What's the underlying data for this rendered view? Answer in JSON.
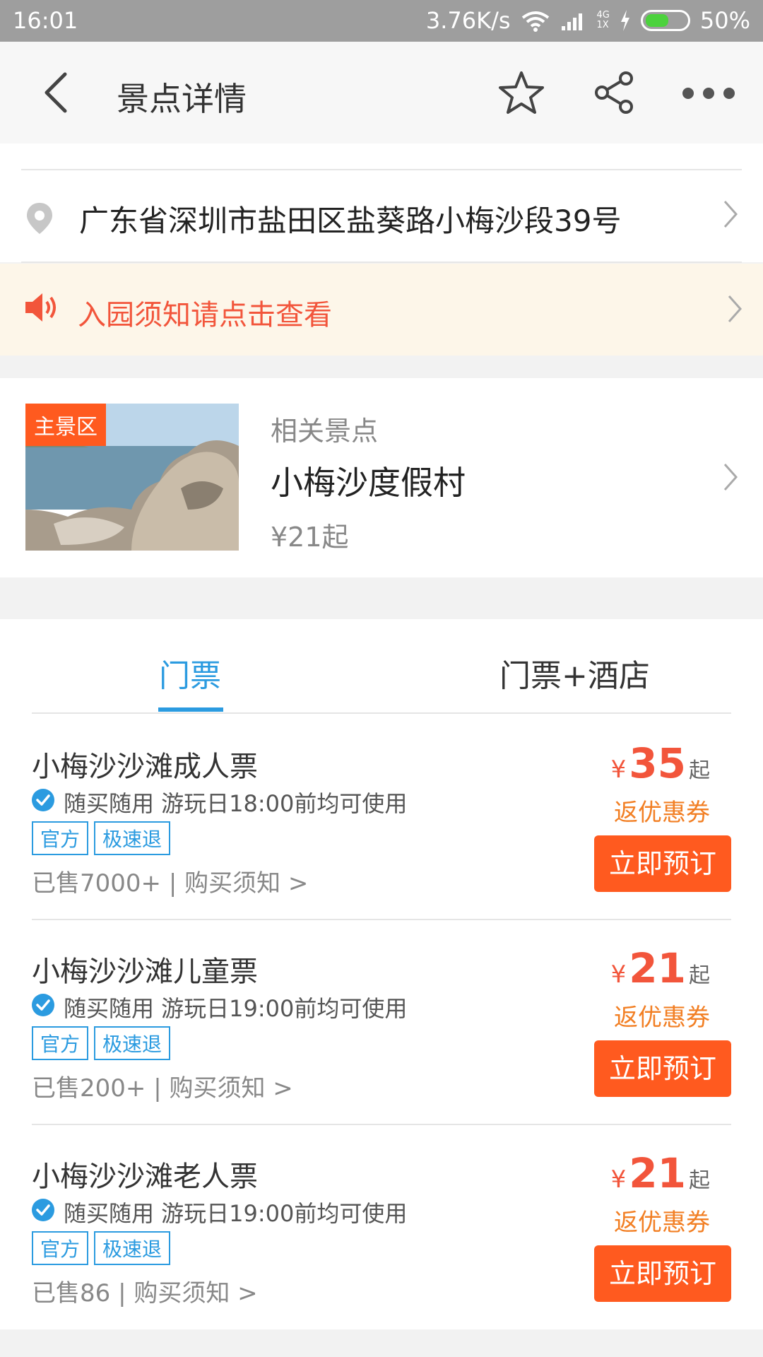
{
  "status_bar": {
    "time": "16:01",
    "speed": "3.76K/s",
    "network_top": "4G",
    "network_bottom": "1X",
    "battery": "50%",
    "battery_level": 0.5
  },
  "header": {
    "title": "景点详情",
    "icons": [
      "back-icon",
      "star-icon",
      "share-icon",
      "more-icon"
    ]
  },
  "address": {
    "text": "广东省深圳市盐田区盐葵路小梅沙段39号"
  },
  "notice": {
    "text": "入园须知请点击查看"
  },
  "related": {
    "badge": "主景区",
    "label": "相关景点",
    "name": "小梅沙度假村",
    "price": "¥21起"
  },
  "tabs": [
    {
      "label": "门票"
    },
    {
      "label": "门票+酒店"
    }
  ],
  "tickets": [
    {
      "name": "小梅沙沙滩成人票",
      "rule": "随买随用 游玩日18:00前均可使用",
      "tags": [
        "官方",
        "极速退"
      ],
      "sold": "已售7000+ | 购买须知 >",
      "currency": "¥",
      "price": "35",
      "suffix": "起",
      "coupon": "返优惠券",
      "button": "立即预订"
    },
    {
      "name": "小梅沙沙滩儿童票",
      "rule": "随买随用 游玩日19:00前均可使用",
      "tags": [
        "官方",
        "极速退"
      ],
      "sold": "已售200+ | 购买须知 >",
      "currency": "¥",
      "price": "21",
      "suffix": "起",
      "coupon": "返优惠券",
      "button": "立即预订"
    },
    {
      "name": "小梅沙沙滩老人票",
      "rule": "随买随用 游玩日19:00前均可使用",
      "tags": [
        "官方",
        "极速退"
      ],
      "sold": "已售86 | 购买须知 >",
      "currency": "¥",
      "price": "21",
      "suffix": "起",
      "coupon": "返优惠券",
      "button": "立即预订"
    }
  ],
  "colors": {
    "accent": "#2b9be0",
    "orange": "#ff5a1f",
    "red": "#f2553b"
  }
}
